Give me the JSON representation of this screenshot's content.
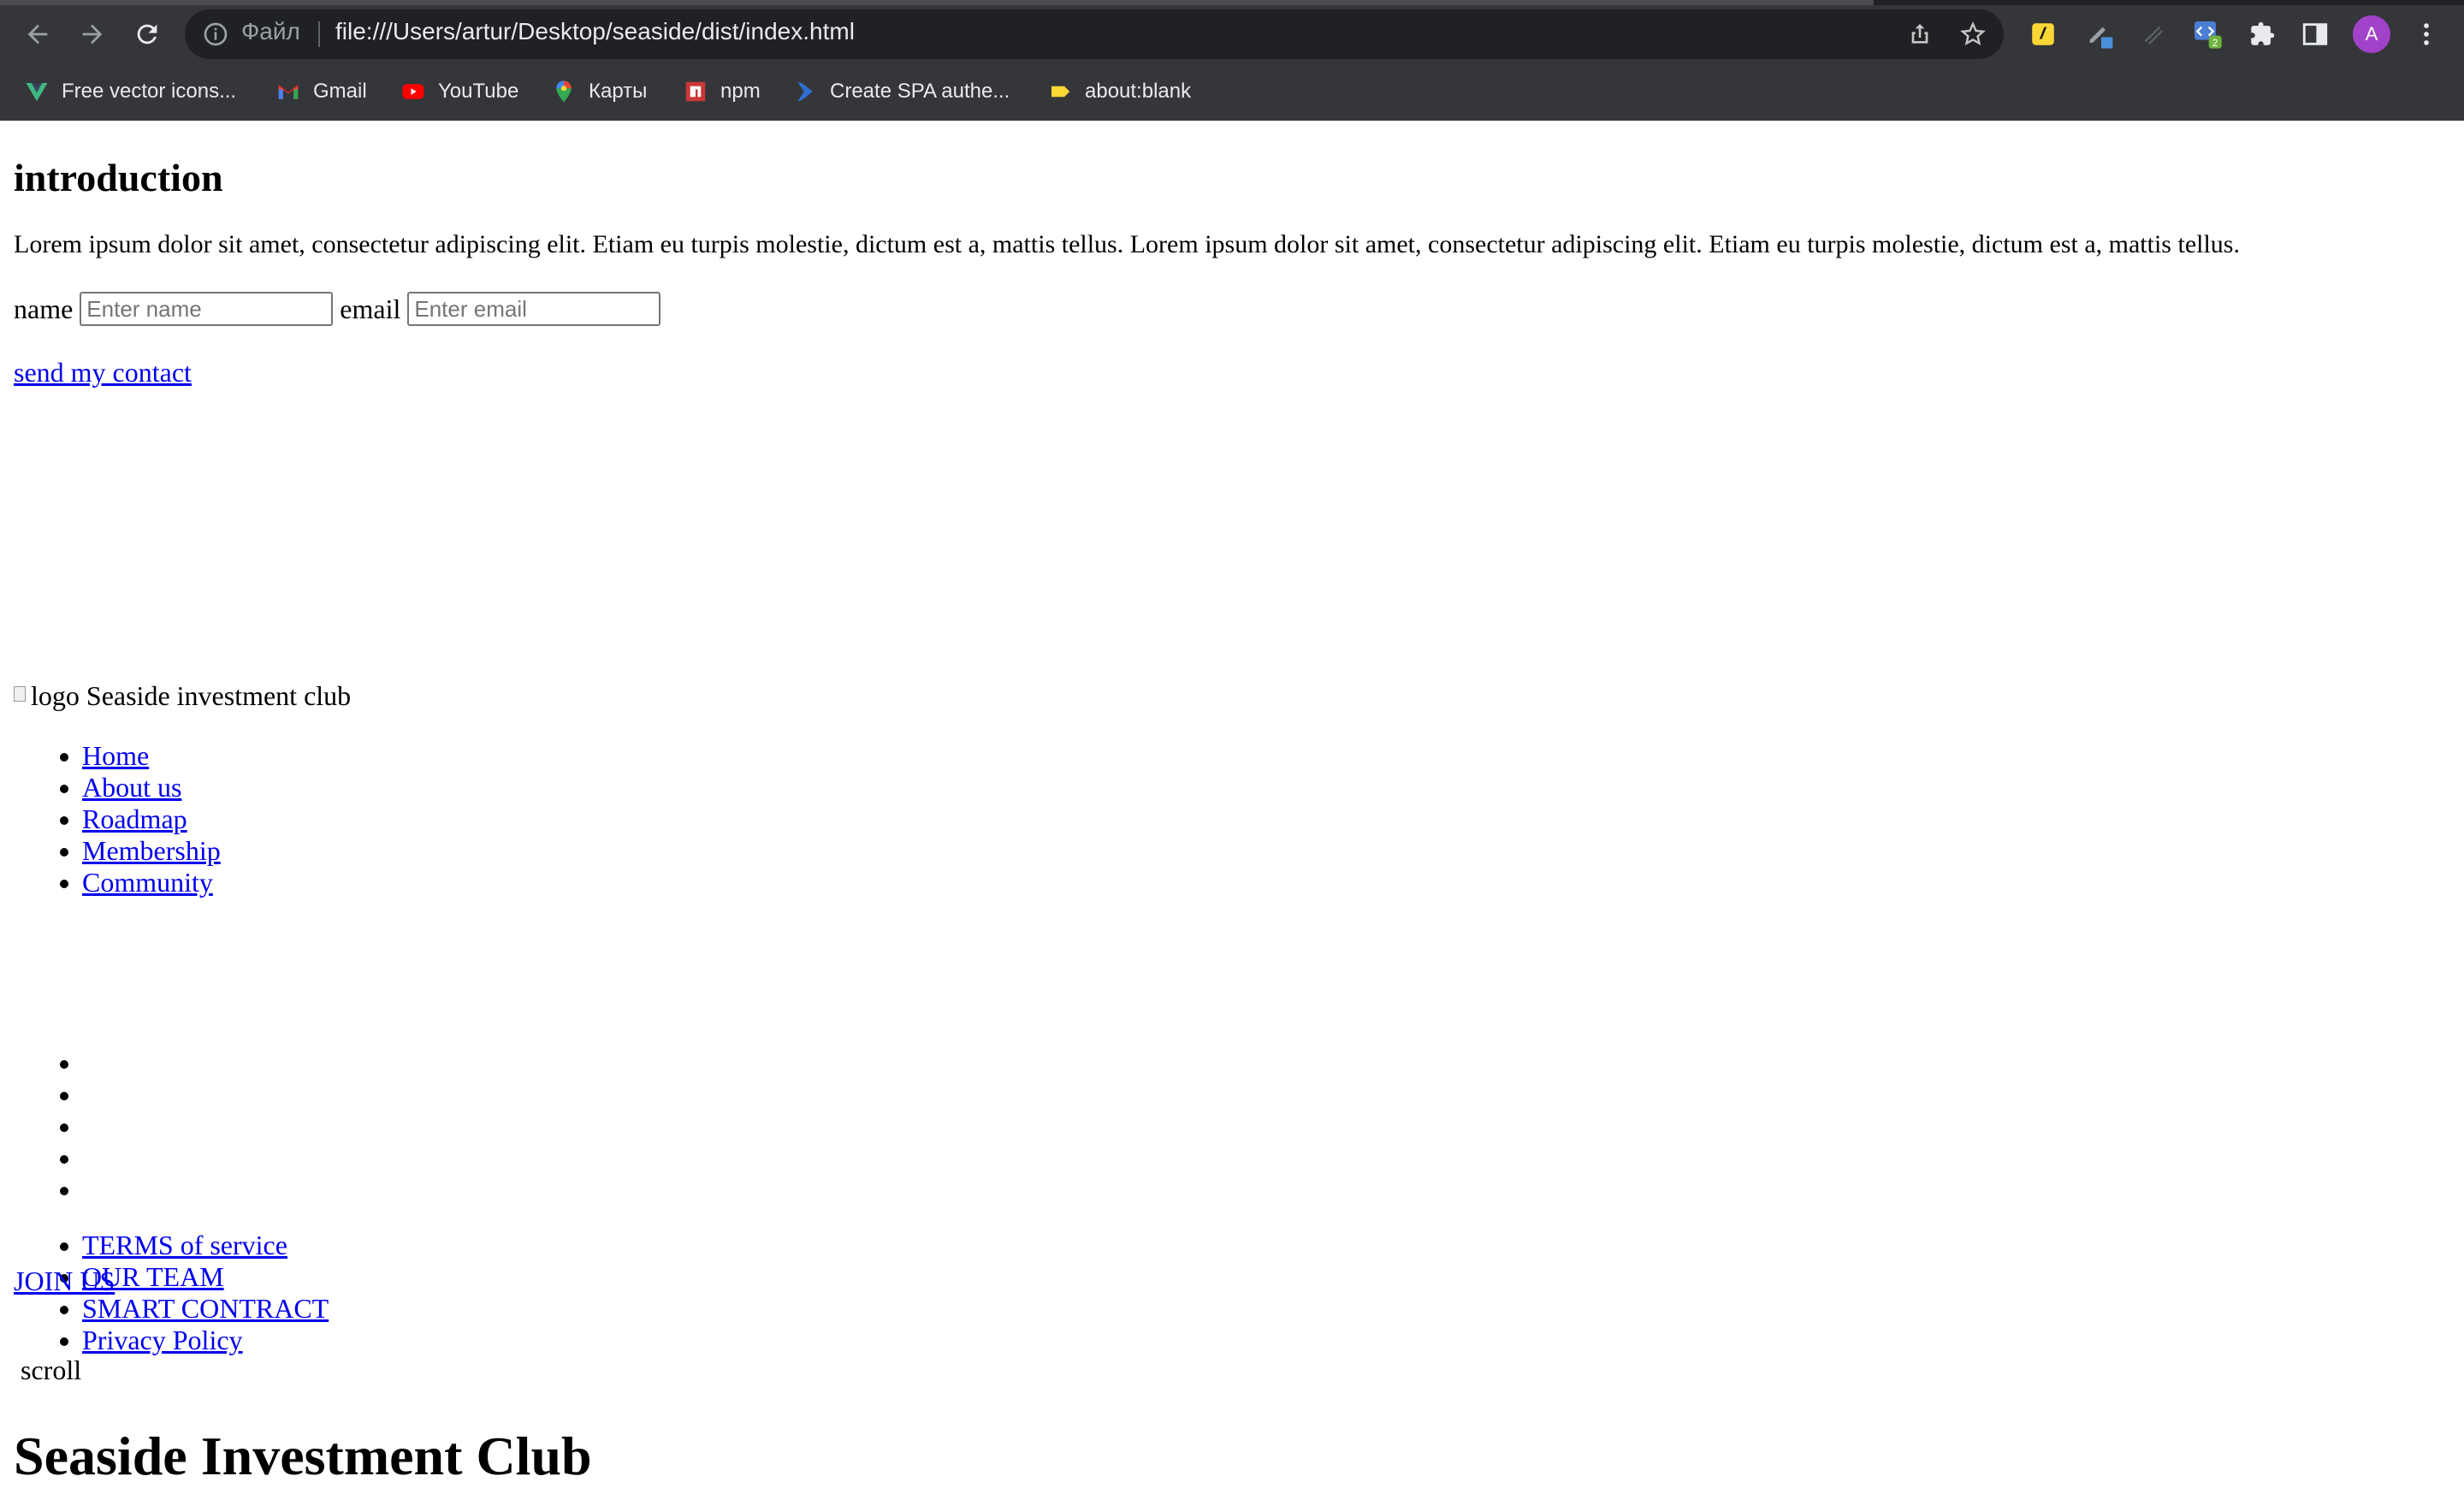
{
  "browser": {
    "file_label": "Файл",
    "url": "file:///Users/artur/Desktop/seaside/dist/index.html",
    "profile_initial": "A",
    "extension_badge": "2",
    "bookmarks": [
      {
        "label": "Free vector icons...",
        "icon": "vue-icon",
        "color": "#41b883"
      },
      {
        "label": "Gmail",
        "icon": "gmail-icon",
        "color": "#ea4335"
      },
      {
        "label": "YouTube",
        "icon": "youtube-icon",
        "color": "#ff0000"
      },
      {
        "label": "Карты",
        "icon": "maps-icon",
        "color": "#34a853"
      },
      {
        "label": "npm",
        "icon": "npm-icon",
        "color": "#cb3837"
      },
      {
        "label": "Create SPA authe...",
        "icon": "azure-icon",
        "color": "#2f6fd1"
      },
      {
        "label": "about:blank",
        "icon": "tag-icon",
        "color": "#fdd835"
      }
    ]
  },
  "page": {
    "intro_heading": "introduction",
    "intro_text": "Lorem ipsum dolor sit amet, consectetur adipiscing elit. Etiam eu turpis molestie, dictum est a, mattis tellus. Lorem ipsum dolor sit amet, consectetur adipiscing elit. Etiam eu turpis molestie, dictum est a, mattis tellus.",
    "form": {
      "name_label": "name",
      "name_placeholder": "Enter name",
      "email_label": "email",
      "email_placeholder": "Enter email"
    },
    "send_link": "send my contact",
    "logo_alt": "logo",
    "club_name": "Seaside investment club",
    "nav": [
      "Home",
      "About us",
      "Roadmap",
      "Membership",
      "Community"
    ],
    "terms": [
      "TERMS of service",
      "OUR TEAM",
      "SMART CONTRACT",
      "Privacy Policy"
    ],
    "join_link": "JOIN US",
    "scroll_label": "scroll",
    "main_title": "Seaside Investment Club"
  }
}
